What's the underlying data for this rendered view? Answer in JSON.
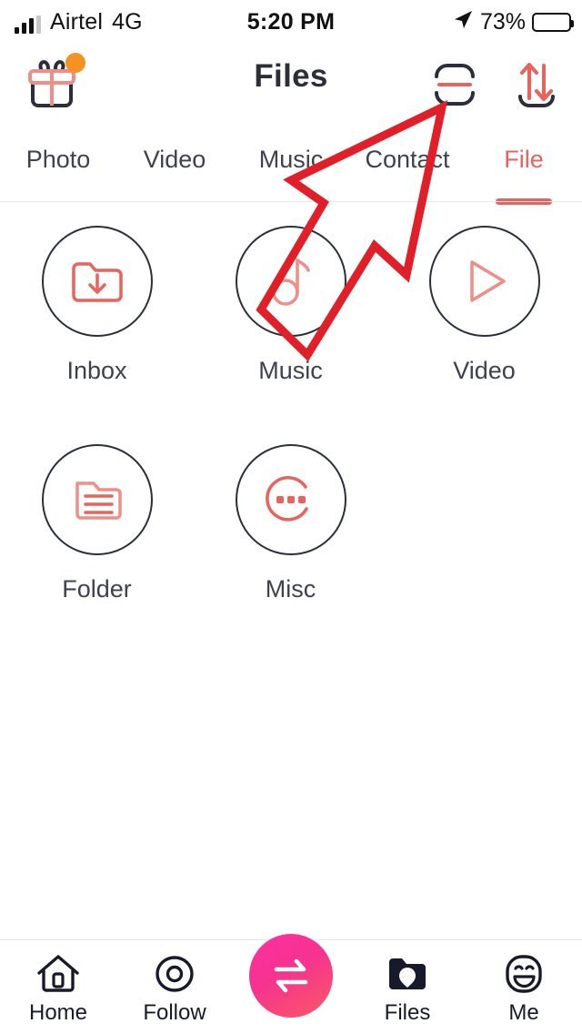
{
  "status_bar": {
    "signal_icon": "signal-bars-icon",
    "carrier": "Airtel",
    "network": "4G",
    "time": "5:20 PM",
    "location_icon": "location-arrow-icon",
    "battery_percent": "73%",
    "battery_icon": "battery-icon"
  },
  "header": {
    "gift_icon": "gift-icon",
    "gift_badge": "notification-dot",
    "title": "Files",
    "scan_icon": "scan-code-icon",
    "transfer_icon": "transfer-arrows-icon"
  },
  "tabs": [
    {
      "label": "Photo",
      "active": false
    },
    {
      "label": "Video",
      "active": false
    },
    {
      "label": "Music",
      "active": false
    },
    {
      "label": "Contact",
      "active": false
    },
    {
      "label": "File",
      "active": true
    }
  ],
  "grid": [
    {
      "label": "Inbox",
      "icon": "folder-download-icon"
    },
    {
      "label": "Music",
      "icon": "music-note-icon"
    },
    {
      "label": "Video",
      "icon": "play-triangle-icon"
    },
    {
      "label": "Folder",
      "icon": "folder-lines-icon"
    },
    {
      "label": "Misc",
      "icon": "more-dots-circle-icon"
    }
  ],
  "annotation": {
    "shape": "arrow-pointing-up-right",
    "color": "#e01f28",
    "points_to": "scan-code-icon"
  },
  "bottom_nav": [
    {
      "label": "Home",
      "icon": "home-icon",
      "active": false
    },
    {
      "label": "Follow",
      "icon": "radar-circle-icon",
      "active": false
    },
    {
      "label": "Files",
      "icon": "folder-filled-icon",
      "active": true
    },
    {
      "label": "Me",
      "icon": "smiley-face-icon",
      "active": false
    }
  ],
  "fab": {
    "icon": "transfer-exchange-icon"
  },
  "colors": {
    "accent_red": "#e8635e",
    "dark_navy": "#2b2f3a",
    "badge_orange": "#f59322",
    "annotation_red": "#e01f28",
    "fab_gradient_start": "#ff2fa0",
    "fab_gradient_end": "#fb5a63"
  }
}
